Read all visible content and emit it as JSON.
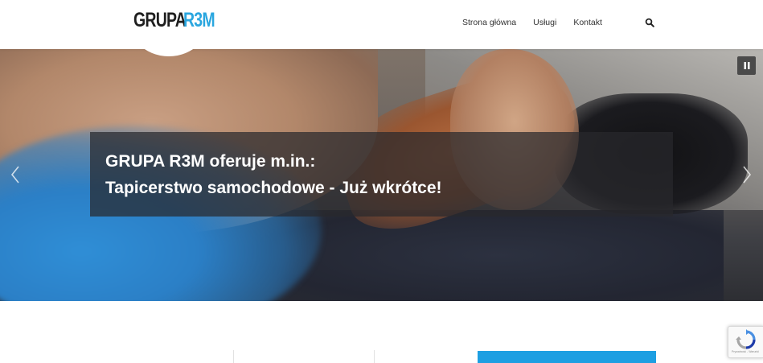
{
  "header": {
    "logo": {
      "part1": "GRUPA",
      "part2": "R3M"
    },
    "nav": [
      {
        "label": "Strona główna"
      },
      {
        "label": "Usługi"
      },
      {
        "label": "Kontakt"
      }
    ],
    "search_icon": "search-icon"
  },
  "hero": {
    "caption": {
      "line1": "GRUPA R3M oferuje m.in.:",
      "line2": "Tapicerstwo samochodowe - Już wkrótce!"
    },
    "pause_icon": "pause-icon",
    "prev_icon": "chevron-left-icon",
    "next_icon": "chevron-right-icon"
  },
  "recaptcha": {
    "footer": "Prywatność - Warunki"
  },
  "colors": {
    "accent": "#1e9fe2",
    "logo_blue": "#2aa6df",
    "text_dark": "#333333",
    "caption_bg": "rgba(40,40,44,0.72)"
  }
}
